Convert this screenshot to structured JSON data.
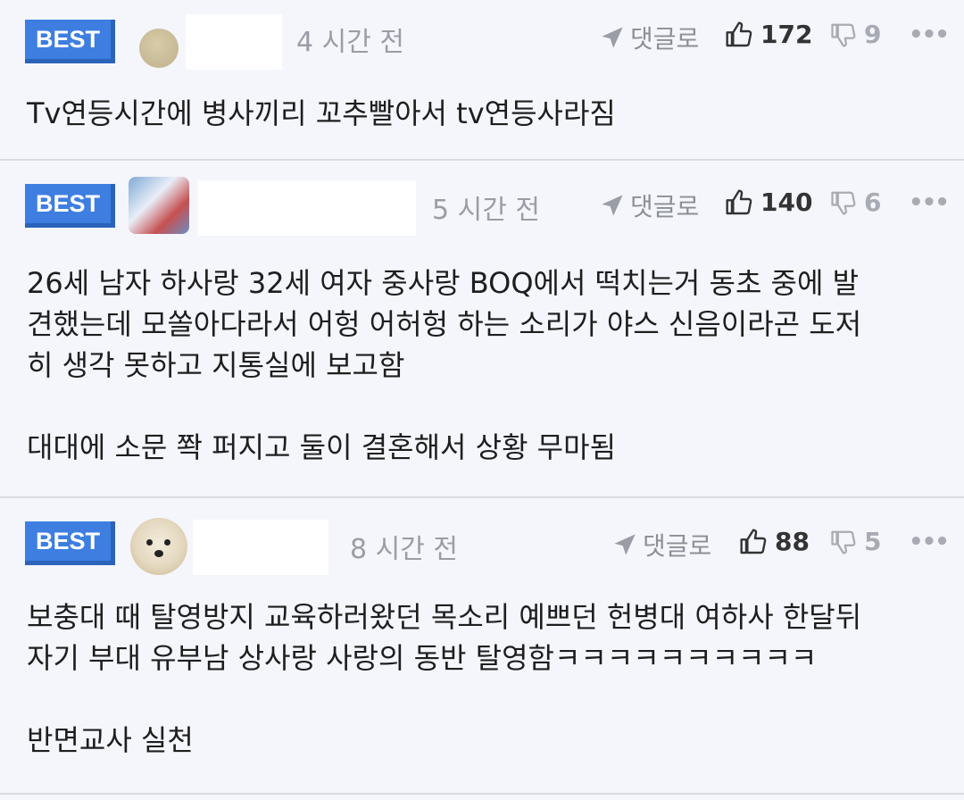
{
  "comments": [
    {
      "badge": "BEST",
      "time": "4 시간 전",
      "reply_label": "댓글로",
      "likes": "172",
      "dislikes": "9",
      "body": [
        "Tv연등시간에 병사끼리 꼬추빨아서 tv연등사라짐"
      ]
    },
    {
      "badge": "BEST",
      "time": "5 시간 전",
      "reply_label": "댓글로",
      "likes": "140",
      "dislikes": "6",
      "body": [
        "26세 남자 하사랑 32세 여자 중사랑 BOQ에서 떡치는거 동초 중에 발",
        "견했는데 모쏠아다라서 어헝 어허헝 하는 소리가 야스 신음이라곤 도저",
        "히 생각 못하고 지통실에 보고함",
        "",
        "대대에 소문 쫙 퍼지고 둘이 결혼해서 상황 무마됨"
      ]
    },
    {
      "badge": "BEST",
      "time": "8 시간 전",
      "reply_label": "댓글로",
      "likes": "88",
      "dislikes": "5",
      "body": [
        "보충대 때 탈영방지 교육하러왔던 목소리 예쁘던 헌병대 여하사 한달뒤",
        "자기 부대 유부남 상사랑 사랑의 동반 탈영함ㅋㅋㅋㅋㅋㅋㅋㅋㅋㅋ",
        "",
        "반면교사 실천"
      ]
    }
  ],
  "more_glyph": "•••",
  "colors": {
    "badge": "#3d7ee0",
    "background": "#f4f6fc",
    "divider": "#d9dbe2"
  },
  "icons": [
    "send-icon",
    "thumbs-up-icon",
    "thumbs-down-icon",
    "more-icon"
  ]
}
